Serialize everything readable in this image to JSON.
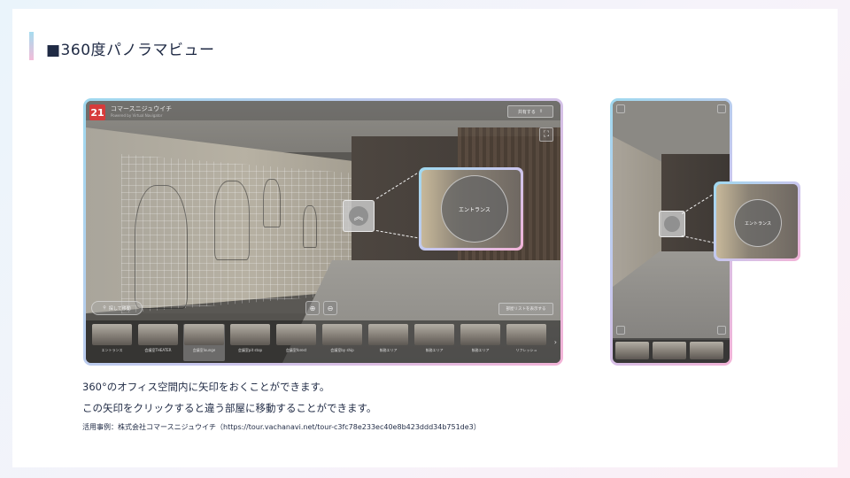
{
  "slide": {
    "title": "■360度パノラマビュー",
    "description_line1": "360°のオフィス空間内に矢印をおくことができます。",
    "description_line2": "この矢印をクリックすると違う部屋に移動することができます。",
    "source": "活用事例：株式会社コマースニジュウイチ（https://tour.vachanavi.net/tour-c3fc78e233ec40e8b423ddd34b751de3）"
  },
  "viewer": {
    "logo_text": "21",
    "brand_name": "コマースニジュウイチ",
    "brand_sub": "Powered by Virtual Navigator",
    "share_label": "共有する",
    "search_label": "探して移動",
    "room_list_label": "部屋リストを表示する",
    "callout_label": "エントランス",
    "thumbnails": [
      {
        "label": "エントランス"
      },
      {
        "label": "会議室THEATER"
      },
      {
        "label": "会議室lounge"
      },
      {
        "label": "会議室pit stop"
      },
      {
        "label": "会議室forest"
      },
      {
        "label": "会議室by ship"
      },
      {
        "label": "執務エリア"
      },
      {
        "label": "執務エリア"
      },
      {
        "label": "執務エリア"
      },
      {
        "label": "リフレッシュ"
      }
    ],
    "active_thumbnail_index": 2
  },
  "side_viewer": {
    "callout_label": "エントランス"
  },
  "colors": {
    "accent_gradient_start": "#9fd9ef",
    "accent_gradient_end": "#f3b3d7",
    "text": "#1f2a44",
    "logo_red": "#d63b3b"
  }
}
